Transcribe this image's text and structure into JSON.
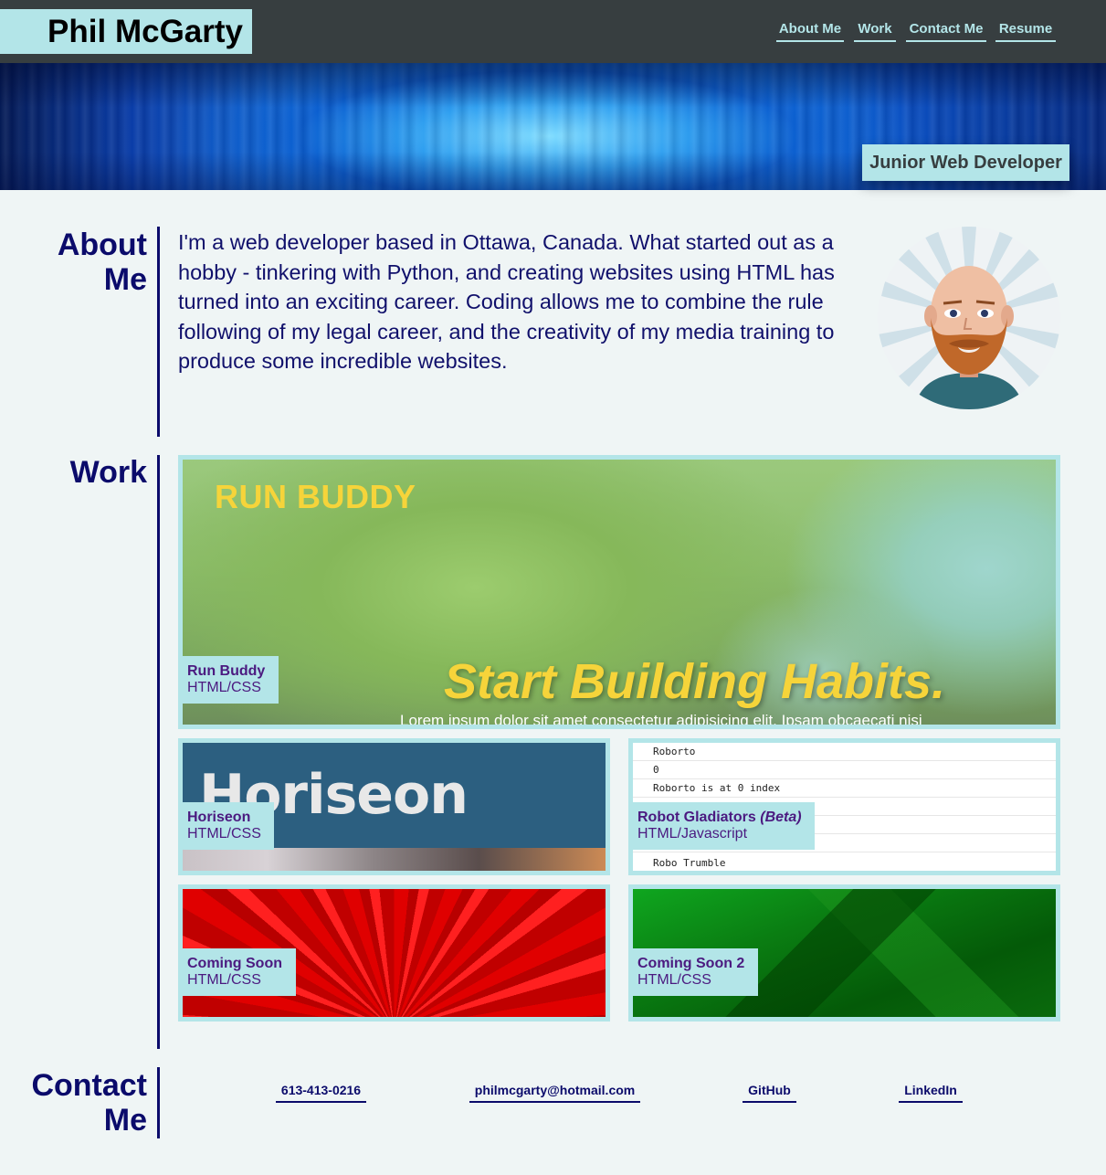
{
  "header": {
    "name": "Phil McGarty",
    "nav": [
      {
        "label": "About Me"
      },
      {
        "label": "Work"
      },
      {
        "label": "Contact Me"
      },
      {
        "label": "Resume"
      }
    ]
  },
  "hero": {
    "badge": "Junior Web Developer"
  },
  "about": {
    "title_line1": "About",
    "title_line2": "Me",
    "text": "I'm a web developer based in Ottawa, Canada. What started out as a hobby - tinkering with Python, and creating websites using HTML has turned into an exciting career. Coding allows me to combine the rule following of my legal career, and the creativity of my media training to produce some incredible websites.",
    "avatar_icon": "cartoon-avatar"
  },
  "work": {
    "title": "Work",
    "featured": {
      "name": "Run Buddy",
      "tech": "HTML/CSS",
      "screenshot_title": "RUN BUDDY",
      "screenshot_slogan": "Start Building Habits.",
      "screenshot_lorem": "Lorem ipsum dolor sit amet consectetur adipisicing elit. Ipsam obcaecati nisi"
    },
    "horiseon": {
      "name": "Horiseon",
      "tech": "HTML/CSS",
      "screenshot_title": "Horiseon"
    },
    "robot": {
      "name": "Robot Gladiators",
      "beta": "(Beta)",
      "tech": "HTML/Javascript",
      "console_lines": [
        "Roborto",
        "0",
        "Roborto is at 0 index",
        "",
        "",
        "",
        "Robo Trumble"
      ]
    },
    "coming1": {
      "name": "Coming Soon",
      "tech": "HTML/CSS"
    },
    "coming2": {
      "name": "Coming Soon 2",
      "tech": "HTML/CSS"
    }
  },
  "contact": {
    "title_line1": "Contact",
    "title_line2": "Me",
    "links": [
      {
        "label": "613-413-0216"
      },
      {
        "label": "philmcgarty@hotmail.com"
      },
      {
        "label": "GitHub"
      },
      {
        "label": "LinkedIn"
      }
    ]
  },
  "colors": {
    "header_bg": "#373e40",
    "accent": "#b3e5e8",
    "navy": "#0b0b6b",
    "page_bg": "#eff5f5",
    "label_text": "#4b1a80",
    "runbuddy_yellow": "#f6d43a"
  }
}
